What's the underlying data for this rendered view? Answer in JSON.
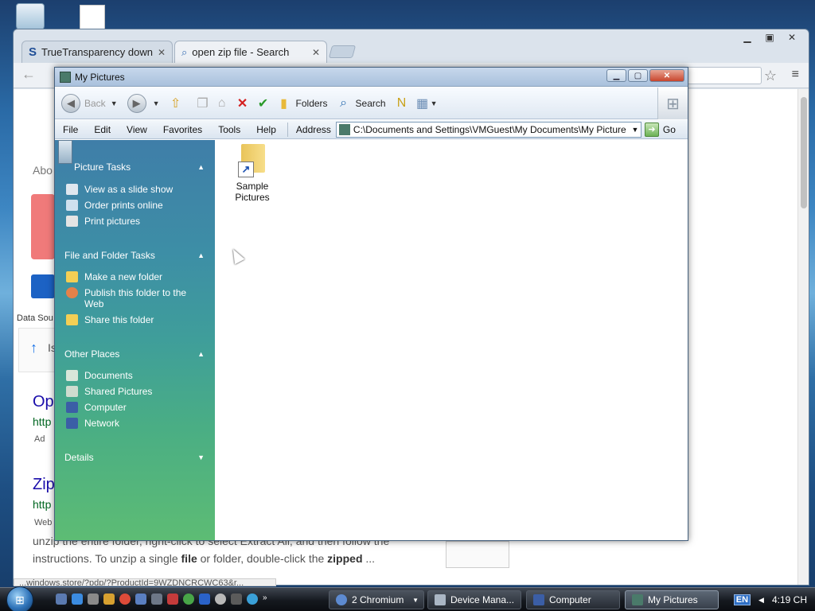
{
  "browser": {
    "tabs": [
      {
        "label": "TrueTransparency downlo",
        "active": false
      },
      {
        "label": "open zip file - Search",
        "active": true
      }
    ],
    "snippet": {
      "line1": "unzip the entire folder, right-click to select Extract All, and then follow the",
      "line2_pre": "instructions. To unzip a single ",
      "line2_b1": "file",
      "line2_mid": " or folder, double-click the ",
      "line2_b2": "zipped",
      "line2_post": " ..."
    },
    "status_url": "...windows.store/?pdp/?ProductId=9WZDNCRCWC63&r...",
    "left_fragments": {
      "abo": "Abo",
      "op": "Op",
      "http1": "http",
      "ad": "Ad",
      "zip": "Zip",
      "http2": "http",
      "web": "Web",
      "data_sou": "Data Sou",
      "is": "Is"
    }
  },
  "explorer": {
    "title": "My Pictures",
    "toolbar": {
      "back": "Back",
      "folders": "Folders",
      "search": "Search"
    },
    "menu": [
      "File",
      "Edit",
      "View",
      "Favorites",
      "Tools",
      "Help"
    ],
    "address_label": "Address",
    "address_value": "C:\\Documents and Settings\\VMGuest\\My Documents\\My Pictures",
    "go": "Go",
    "sidebar": {
      "picture_tasks": {
        "title": "Picture Tasks",
        "items": [
          "View as a slide show",
          "Order prints online",
          "Print pictures"
        ]
      },
      "file_folder_tasks": {
        "title": "File and Folder Tasks",
        "items": [
          "Make a new folder",
          "Publish this folder to the Web",
          "Share this folder"
        ]
      },
      "other_places": {
        "title": "Other Places",
        "items": [
          "Documents",
          "Shared Pictures",
          "Computer",
          "Network"
        ]
      },
      "details": {
        "title": "Details"
      }
    },
    "items": [
      {
        "name": "Sample Pictures",
        "icon": "folder-shortcut-icon"
      }
    ]
  },
  "taskbar": {
    "buttons": [
      {
        "label": "2 Chromium",
        "active": false
      },
      {
        "label": "Device Mana...",
        "active": false
      },
      {
        "label": "Computer",
        "active": false
      },
      {
        "label": "My Pictures",
        "active": true
      }
    ],
    "language": "EN",
    "clock": "4:19 CH"
  },
  "colors": {
    "sidebar_top": "#3f7ea8",
    "sidebar_bottom": "#5dbc74",
    "link_blue": "#1a0dab",
    "url_green": "#006621"
  }
}
